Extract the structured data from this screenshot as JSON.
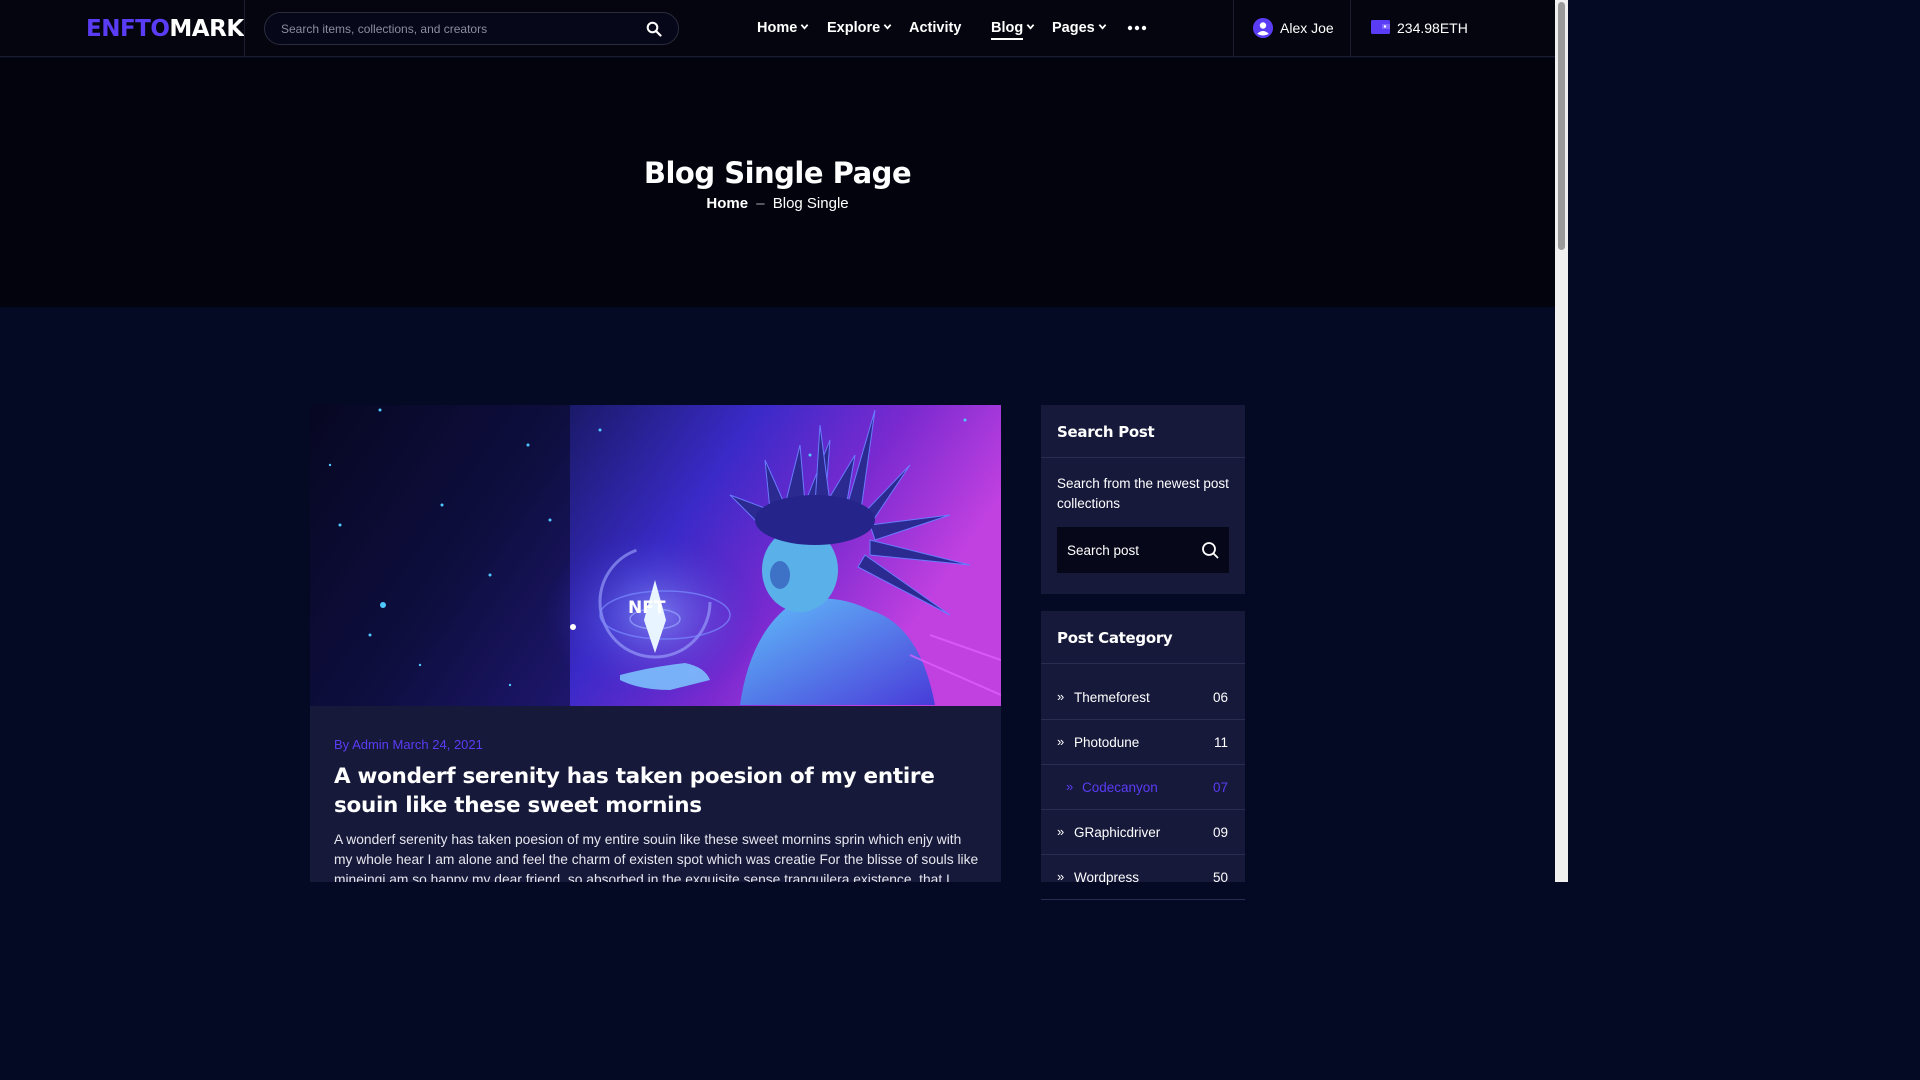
{
  "brand": {
    "part1": "ENFTO",
    "part2": "MARK"
  },
  "search": {
    "placeholder": "Search items, collections, and creators"
  },
  "nav": [
    {
      "label": "Home",
      "has_dropdown": true
    },
    {
      "label": "Explore",
      "has_dropdown": true
    },
    {
      "label": "Activity",
      "has_dropdown": false
    },
    {
      "label": "Blog",
      "has_dropdown": true,
      "active": true
    },
    {
      "label": "Pages",
      "has_dropdown": true
    }
  ],
  "user": {
    "name": "Alex Joe"
  },
  "wallet": {
    "balance": "234.98ETH"
  },
  "hero": {
    "title": "Blog Single Page",
    "breadcrumb_home": "Home",
    "breadcrumb_sep": "–",
    "breadcrumb_current": "Blog Single"
  },
  "post": {
    "meta": "By Admin March 24, 2021",
    "image_text": "NFT",
    "title": "A wonderf serenity has taken poesion of my entire souin like these sweet mornins",
    "body": "A wonderf serenity has taken poesion of my entire souin like these sweet mornins sprin which enjy with my whole hear I am alone and feel the charm of existen spot which was creatie For the blisse of souls like mineingi am so happy my dear friend, so absorbed in the exquisite sense tranquilera existence, that I neglect my"
  },
  "sidebar": {
    "search_widget": {
      "title": "Search Post",
      "description": "Search from the newest post collections",
      "placeholder": "Search post"
    },
    "category_widget": {
      "title": "Post Category",
      "items": [
        {
          "name": "Themeforest",
          "count": "06"
        },
        {
          "name": "Photodune",
          "count": "11"
        },
        {
          "name": "Codecanyon",
          "count": "07",
          "active": true
        },
        {
          "name": "GRaphicdriver",
          "count": "09"
        },
        {
          "name": "Wordpress",
          "count": "50"
        }
      ]
    }
  },
  "colors": {
    "accent": "#5b3cf5",
    "header_bg": "#05050f",
    "hero_bg": "#03030e",
    "page_bg": "#050a24",
    "card_bg": "#16193a"
  }
}
